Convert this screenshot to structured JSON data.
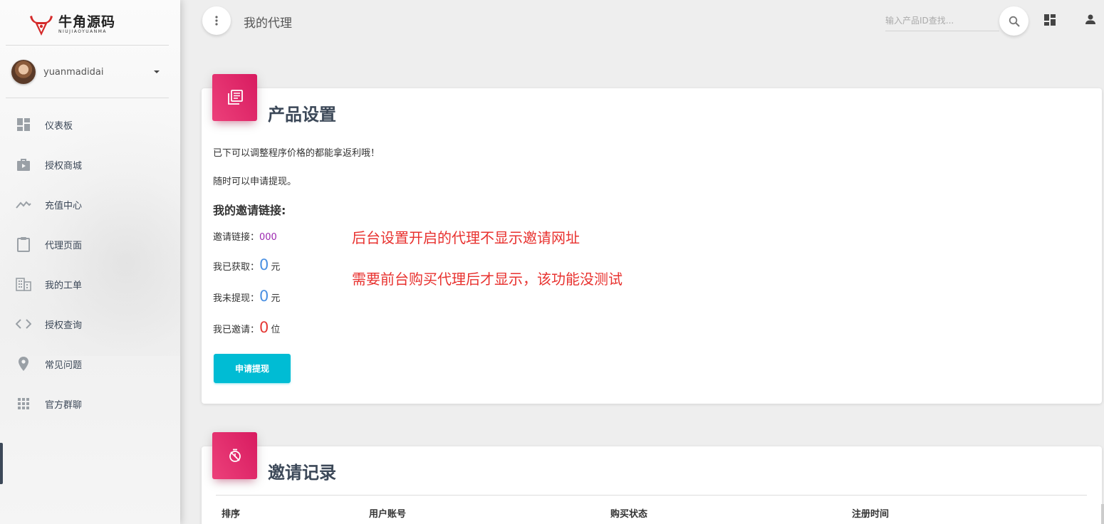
{
  "sidebar": {
    "logo": {
      "name": "牛角源码",
      "sub": "NIUJIAOYUANMA"
    },
    "user": {
      "name": "yuanmadidai"
    },
    "items": [
      {
        "label": "仪表板",
        "icon": "dashboard-icon"
      },
      {
        "label": "授权商城",
        "icon": "store-bag-icon"
      },
      {
        "label": "充值中心",
        "icon": "trending-line-icon"
      },
      {
        "label": "代理页面",
        "icon": "clipboard-icon"
      },
      {
        "label": "我的工单",
        "icon": "building-icon"
      },
      {
        "label": "授权查询",
        "icon": "code-brackets-icon"
      },
      {
        "label": "常见问题",
        "icon": "location-pin-icon"
      },
      {
        "label": "官方群聊",
        "icon": "apps-grid-icon"
      }
    ]
  },
  "topbar": {
    "title": "我的代理",
    "search_placeholder": "输入产品ID查找..."
  },
  "product_card": {
    "title": "产品设置",
    "line1": "已下可以调整程序价格的都能拿返利哦！",
    "line2": "随时可以申请提现。",
    "invite_heading": "我的邀请链接:",
    "invite_link_label": "邀请链接：",
    "invite_link_value": "000",
    "earned_label": "我已获取：",
    "earned_value": "0",
    "earned_unit": "元",
    "unwithdrawn_label": "我未提现：",
    "unwithdrawn_value": "0",
    "unwithdrawn_unit": "元",
    "invited_label": "我已邀请：",
    "invited_value": "0",
    "invited_unit": "位",
    "withdraw_button": "申请提现",
    "note1": "后台设置开启的代理不显示邀请网址",
    "note2": "需要前台购买代理后才显示，该功能没测试"
  },
  "invite_card": {
    "title": "邀请记录",
    "columns": [
      "排序",
      "用户账号",
      "购买状态",
      "注册时间"
    ]
  },
  "colors": {
    "accent_pink": "#e91e63",
    "accent_cyan": "#00bcd4",
    "link_purple": "#9c27b0",
    "stat_blue": "#4a90e2",
    "stat_red": "#e53935",
    "note_red": "#e8322f"
  }
}
